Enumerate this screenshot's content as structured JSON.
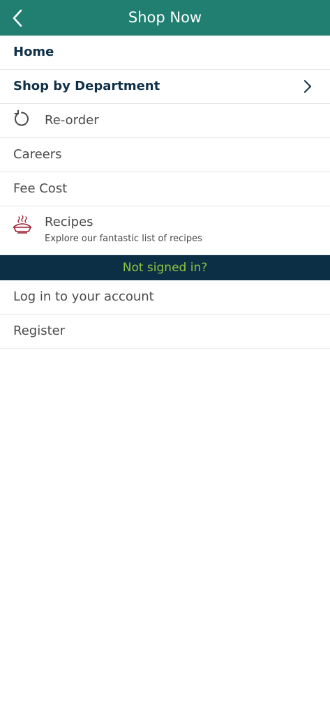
{
  "header": {
    "title": "Shop Now",
    "back_icon": "chevron-left-icon",
    "background_color": "#217f72"
  },
  "menu": {
    "home": "Home",
    "shop_by_department": "Shop by Department",
    "reorder": "Re-order",
    "careers": "Careers",
    "fee_cost": "Fee Cost",
    "recipes": {
      "title": "Recipes",
      "subtitle": "Explore our fantastic list of recipes",
      "icon": "recipe-bowl-icon"
    }
  },
  "banner": {
    "text": "Not signed in?",
    "background_color": "#0c2f46",
    "text_color": "#8dc63f"
  },
  "account": {
    "login": "Log in to your account",
    "register": "Register"
  }
}
